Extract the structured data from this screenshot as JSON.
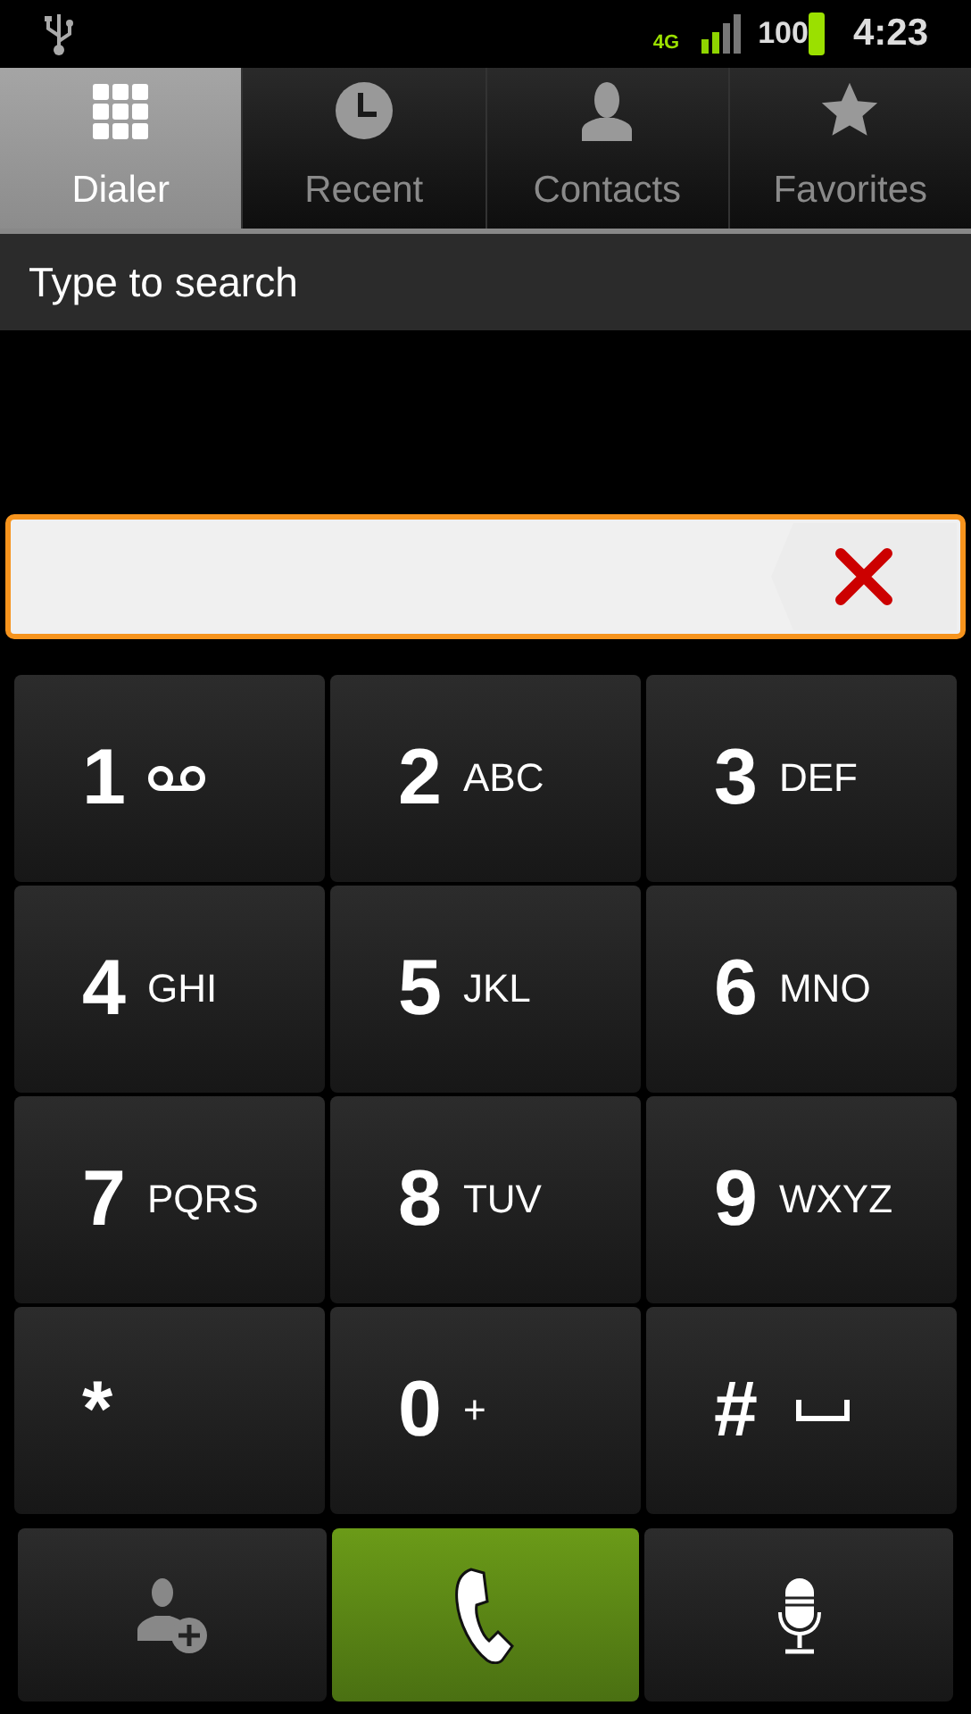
{
  "status_bar": {
    "network": "4G",
    "battery": "100",
    "time": "4:23"
  },
  "tabs": [
    {
      "label": "Dialer",
      "selected": true,
      "kind": "dialpad"
    },
    {
      "label": "Recent",
      "selected": false,
      "kind": "clock"
    },
    {
      "label": "Contacts",
      "selected": false,
      "kind": "person"
    },
    {
      "label": "Favorites",
      "selected": false,
      "kind": "star"
    }
  ],
  "search": {
    "placeholder": "Type to search"
  },
  "keys": [
    {
      "digit": "1",
      "kind": "voicemail"
    },
    {
      "digit": "2",
      "letters": "ABC",
      "kind": "text"
    },
    {
      "digit": "3",
      "letters": "DEF",
      "kind": "text"
    },
    {
      "digit": "4",
      "letters": "GHI",
      "kind": "text"
    },
    {
      "digit": "5",
      "letters": "JKL",
      "kind": "text"
    },
    {
      "digit": "6",
      "letters": "MNO",
      "kind": "text"
    },
    {
      "digit": "7",
      "letters": "PQRS",
      "kind": "text"
    },
    {
      "digit": "8",
      "letters": "TUV",
      "kind": "text"
    },
    {
      "digit": "9",
      "letters": "WXYZ",
      "kind": "text"
    },
    {
      "digit": "*",
      "kind": "text"
    },
    {
      "digit": "0",
      "letters": "+",
      "kind": "text"
    },
    {
      "digit": "#",
      "kind": "space"
    }
  ]
}
